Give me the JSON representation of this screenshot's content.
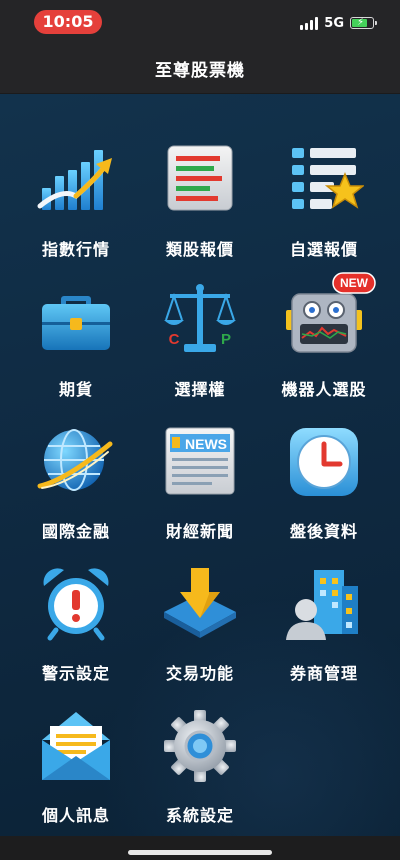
{
  "status_bar": {
    "time": "10:05",
    "network": "5G",
    "battery_level": 0.75,
    "battery_charging": true,
    "time_pill_color": "#e5403b",
    "battery_color": "#45d15a"
  },
  "app": {
    "title": "至尊股票機"
  },
  "menu": [
    {
      "label": "指數行情",
      "icon": "rising-chart-icon"
    },
    {
      "label": "類股報價",
      "icon": "sector-list-icon"
    },
    {
      "label": "自選報價",
      "icon": "watchlist-star-icon"
    },
    {
      "label": "期貨",
      "icon": "briefcase-icon"
    },
    {
      "label": "選擇權",
      "icon": "balance-scale-icon"
    },
    {
      "label": "機器人選股",
      "icon": "robot-icon",
      "badge": "NEW"
    },
    {
      "label": "國際金融",
      "icon": "globe-icon"
    },
    {
      "label": "財經新聞",
      "icon": "newspaper-icon",
      "icon_text": "NEWS"
    },
    {
      "label": "盤後資料",
      "icon": "clock-icon"
    },
    {
      "label": "警示設定",
      "icon": "alarm-clock-icon"
    },
    {
      "label": "交易功能",
      "icon": "download-arrow-icon"
    },
    {
      "label": "券商管理",
      "icon": "broker-building-icon"
    },
    {
      "label": "個人訊息",
      "icon": "mail-envelope-icon"
    },
    {
      "label": "系統設定",
      "icon": "gear-icon"
    }
  ],
  "option_icon_letters": {
    "call": "C",
    "put": "P"
  }
}
